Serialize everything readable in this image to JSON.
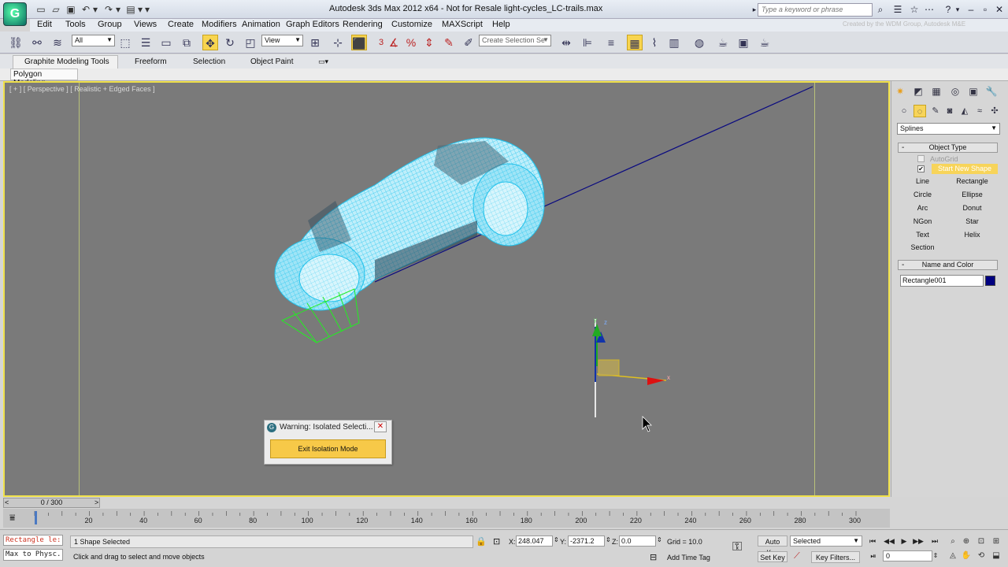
{
  "title_bar": {
    "window_title": "Autodesk 3ds Max  2012 x64   -  Not for Resale   light-cycles_LC-trails.max",
    "app_logo": "G",
    "search_placeholder": "Type a keyword or phrase",
    "quick_access_icons": [
      "new-file-icon",
      "open-file-icon",
      "save-icon",
      "undo-icon",
      "undo-dropdown-icon",
      "redo-icon",
      "redo-dropdown-icon",
      "project-folder-icon",
      "project-dropdown-icon",
      "customize-dropdown-icon"
    ],
    "right_icons": [
      "binoculars-icon",
      "star-icon",
      "comm-center-icon",
      "help-icon",
      "help-dropdown-icon"
    ],
    "window_controls": [
      "minimize-icon",
      "maximize-icon",
      "close-icon"
    ]
  },
  "menu": {
    "items": [
      "Edit",
      "Tools",
      "Group",
      "Views",
      "Create",
      "Modifiers",
      "Animation",
      "Graph Editors",
      "Rendering",
      "Customize",
      "MAXScript",
      "Help"
    ],
    "watermark": "Created by the WDM Group, Autodesk M&E"
  },
  "main_toolbar": {
    "selection_filter": "All",
    "ref_coord": "View",
    "named_selection_placeholder": "Create Selection Se",
    "snap_label": "3"
  },
  "ribbon": {
    "tabs": [
      "Graphite Modeling Tools",
      "Freeform",
      "Selection",
      "Object Paint"
    ],
    "panel": "Polygon Modeling"
  },
  "viewport": {
    "label": "[ + ] [ Perspective ] [ Realistic + Edged Faces ]",
    "gizmo_axes": {
      "x": "x",
      "y": "y",
      "z": "z"
    }
  },
  "dialog": {
    "title": "Warning: Isolated Selecti...",
    "button": "Exit Isolation Mode"
  },
  "command_panel": {
    "category": "Splines",
    "object_type_title": "Object Type",
    "autogrid": "AutoGrid",
    "start_new_shape": "Start New Shape",
    "start_new_shape_check": "✔",
    "buttons": [
      "Line",
      "Rectangle",
      "Circle",
      "Ellipse",
      "Arc",
      "Donut",
      "NGon",
      "Star",
      "Text",
      "Helix",
      "Section"
    ],
    "name_color_title": "Name and Color",
    "object_name": "Rectangle001",
    "object_color": "#000080",
    "rollout_minus": "-"
  },
  "time_slider": {
    "label": "0 / 300",
    "prev": "<",
    "next": ">"
  },
  "trackbar": {
    "ticks": [
      "20",
      "40",
      "60",
      "80",
      "100",
      "120",
      "140",
      "160",
      "180",
      "200",
      "220",
      "240",
      "260",
      "280",
      "300"
    ]
  },
  "status": {
    "maxscript_line1": "Rectangle le:",
    "maxscript_line2": "Max to Physc.",
    "selection_info": "1 Shape Selected",
    "prompt": "Click and drag to select and move objects",
    "x_label": "X:",
    "x_value": "248.047",
    "y_label": "Y:",
    "y_value": "-2371.2",
    "z_label": "Z:",
    "z_value": "0.0",
    "grid": "Grid = 10.0",
    "add_time_tag": "Add Time Tag",
    "auto_key": "Auto Key",
    "set_key": "Set Key",
    "selected_set": "Selected",
    "key_filters": "Key Filters...",
    "current_frame": "0"
  },
  "colors": {
    "viewport_bg": "#7a7a7a",
    "active_border": "#f0e14a",
    "wireframe": "#22c6ee",
    "spline": "#000080",
    "highlight": "#f7c948"
  }
}
